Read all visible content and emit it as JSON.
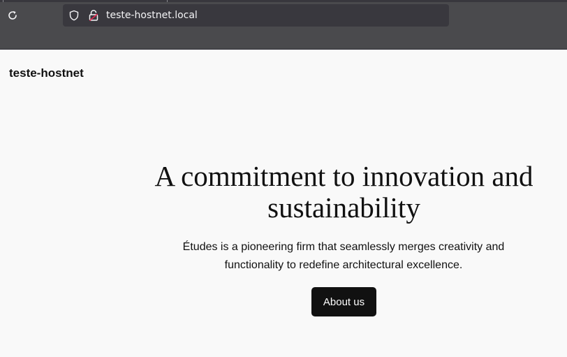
{
  "browser": {
    "url": "teste-hostnet.local",
    "icons": {
      "reload": "reload-icon",
      "tracking": "shield-icon",
      "security": "broken-lock-icon"
    }
  },
  "site": {
    "title": "teste-hostnet"
  },
  "hero": {
    "heading": "A commitment to innovation and sustainability",
    "text": "Études is a pioneering firm that seamlessly merges creativity and functionality to redefine architectural excellence.",
    "button_label": "About us"
  },
  "colors": {
    "chrome": "#4a4a4d",
    "urlbar": "#39383e",
    "page_background": "#f9f9f9",
    "button": "#111111",
    "lock_accent": "#e22850"
  }
}
